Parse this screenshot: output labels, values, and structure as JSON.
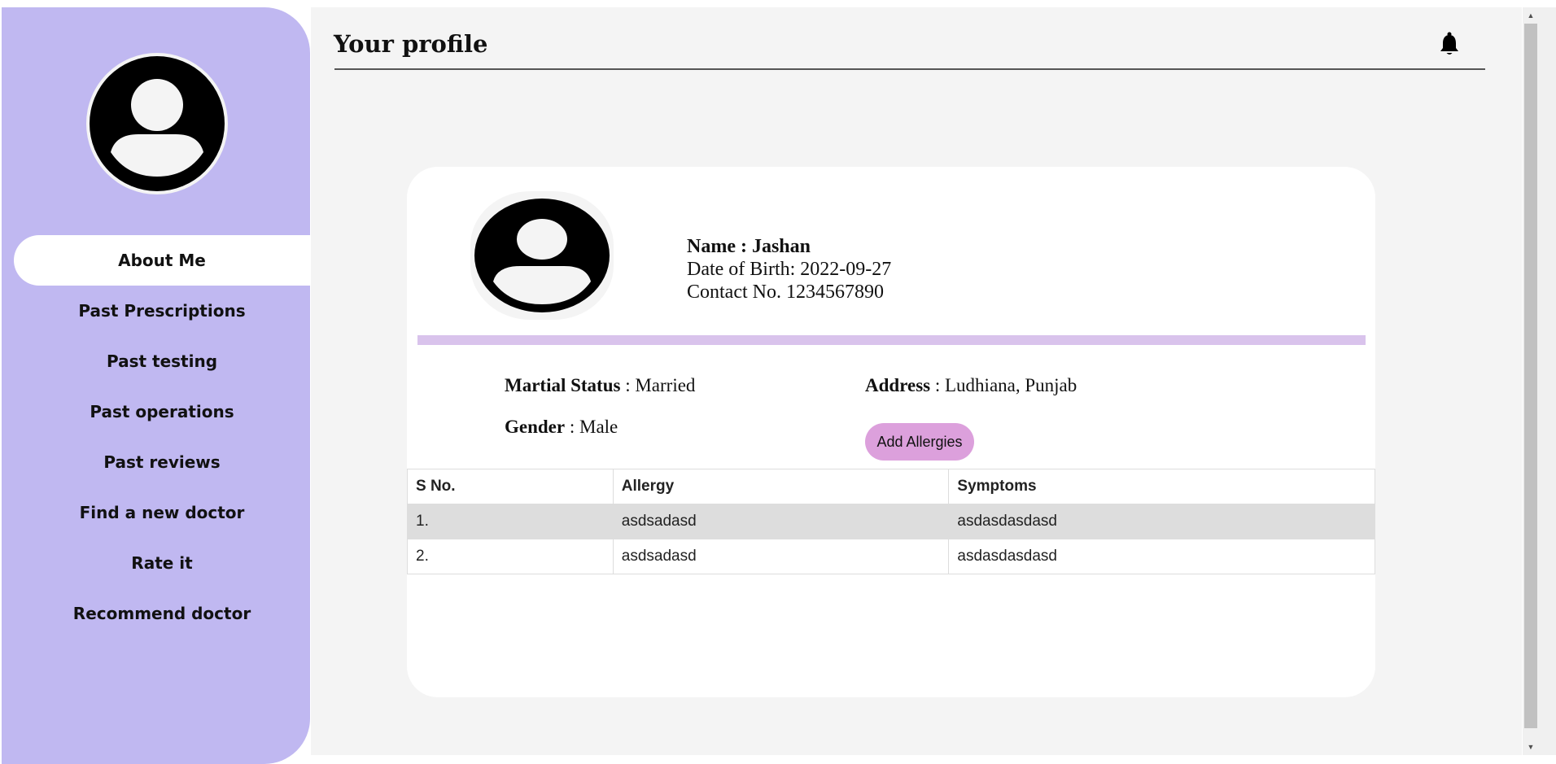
{
  "sidebar": {
    "items": [
      {
        "label": "About Me"
      },
      {
        "label": "Past Prescriptions"
      },
      {
        "label": "Past testing"
      },
      {
        "label": "Past operations"
      },
      {
        "label": "Past reviews"
      },
      {
        "label": "Find a new doctor"
      },
      {
        "label": "Rate it"
      },
      {
        "label": "Recommend doctor"
      }
    ],
    "active_index": 0
  },
  "header": {
    "title": "Your profile",
    "bell_icon": "bell-icon"
  },
  "profile": {
    "name_label": "Name : Jashan",
    "dob_label": "Date of Birth: 2022-09-27",
    "contact_label": "Contact No. 1234567890",
    "marital_status": {
      "label": "Martial Status",
      "value": " : Married"
    },
    "address": {
      "label": "Address",
      "value": " : Ludhiana, Punjab"
    },
    "gender": {
      "label": "Gender",
      "value": " : Male"
    },
    "add_allergies_label": "Add Allergies"
  },
  "allergy_table": {
    "headers": [
      "S No.",
      "Allergy",
      "Symptoms"
    ],
    "rows": [
      [
        "1.",
        "asdsadasd",
        "asdasdasdasd"
      ],
      [
        "2.",
        "asdsadasd",
        "asdasdasdasd"
      ]
    ]
  },
  "colors": {
    "sidebar_bg": "#c0b8f1",
    "divider": "#d9c3ec",
    "button": "#dca0dc",
    "main_bg": "#f4f4f4"
  }
}
